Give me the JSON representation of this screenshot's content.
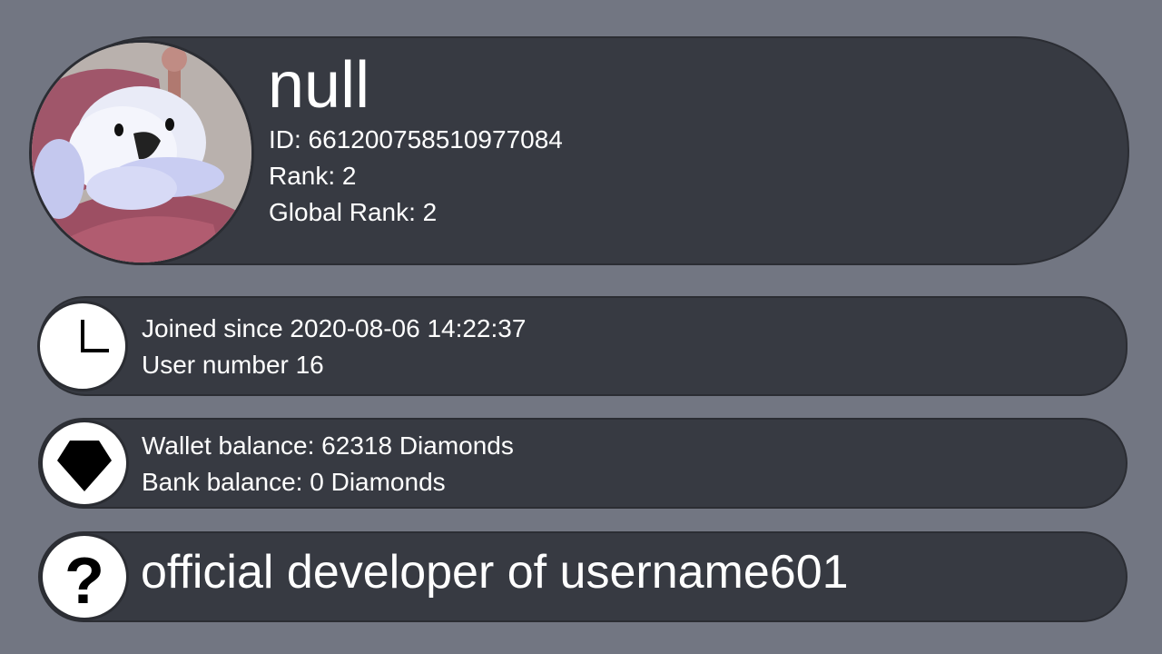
{
  "profile": {
    "username": "null",
    "id_line": "ID: 661200758510977084",
    "rank_line": "Rank: 2",
    "global_rank_line": "Global Rank: 2",
    "avatar_icon": "cartoon-avatar"
  },
  "membership": {
    "icon": "clock-icon",
    "joined_line": "Joined since 2020-08-06 14:22:37",
    "user_number_line": "User number 16"
  },
  "balances": {
    "icon": "diamond-icon",
    "wallet_line": "Wallet balance: 62318 Diamonds",
    "bank_line": "Bank balance: 0 Diamonds"
  },
  "bio": {
    "icon": "question-mark-icon",
    "text": "official developer of username601"
  },
  "colors": {
    "background": "#727682",
    "card": "#373a42",
    "text": "#ffffff"
  }
}
